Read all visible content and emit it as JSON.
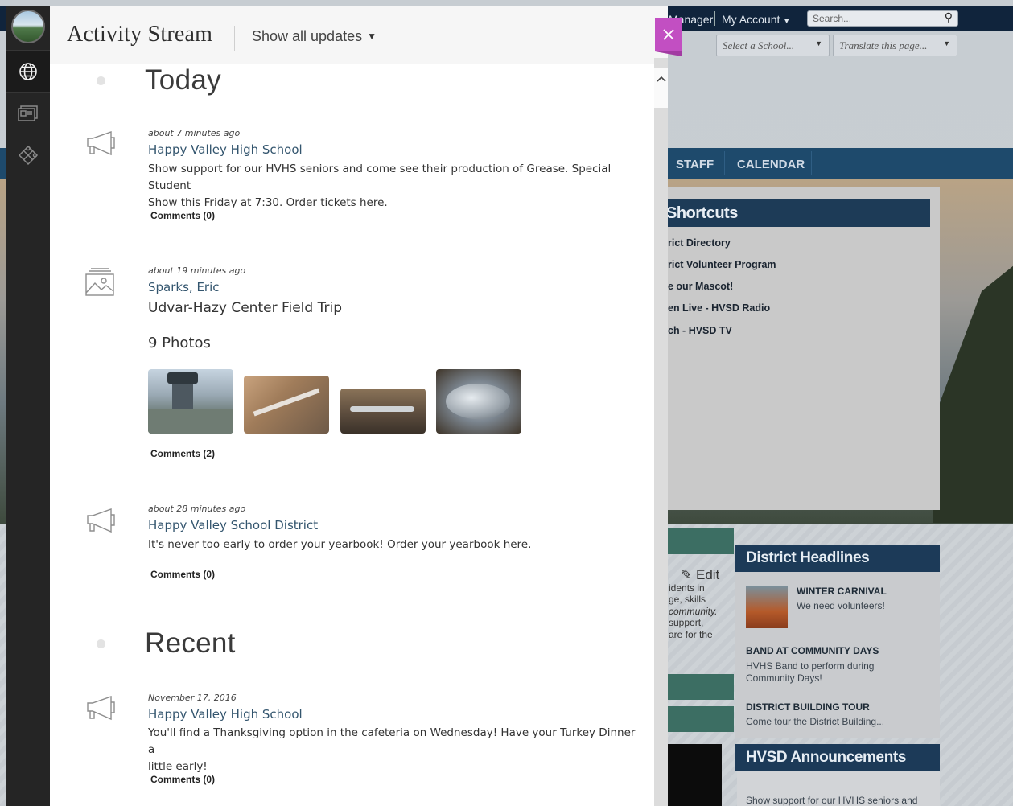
{
  "panel": {
    "title": "Activity Stream",
    "filter_label": "Show all updates"
  },
  "sections": [
    {
      "title": "Today"
    },
    {
      "title": "Recent"
    }
  ],
  "posts": [
    {
      "time": "about 7 minutes ago",
      "author": "Happy Valley High School",
      "body_line1": "Show support for our HVHS seniors and come see their production of Grease. Special Student",
      "body_line2": "Show this Friday at 7:30. Order tickets here.",
      "comments": "Comments (0)"
    },
    {
      "time": "about 19 minutes ago",
      "author": "Sparks, Eric",
      "headline": "Udvar-Hazy Center Field Trip",
      "photo_count": "9 Photos",
      "comments": "Comments (2)"
    },
    {
      "time": "about 28 minutes ago",
      "author": "Happy Valley School District",
      "body_line1": "It's never too early to order your yearbook! Order your yearbook here.",
      "comments": "Comments (0)"
    },
    {
      "time": "November 17, 2016",
      "author": "Happy Valley High School",
      "body_line1": "You'll find a Thanksgiving option in the cafeteria on Wednesday! Have your Turkey Dinner a",
      "body_line2": "little early!",
      "comments": "Comments (0)"
    }
  ],
  "background_site": {
    "top_links": [
      "Manager",
      "My Account"
    ],
    "search_placeholder": "Search...",
    "school_select": "Select a School...",
    "translate_select": "Translate this page...",
    "nav": [
      "STAFF",
      "CALENDAR"
    ],
    "shortcuts_title": "Shortcuts",
    "shortcuts": [
      "rict Directory",
      "rict Volunteer Program",
      "e our Mascot!",
      "en Live - HVSD Radio",
      "ch - HVSD TV"
    ],
    "edit_label": "Edit",
    "partial_text": [
      "idents in",
      "ge, skills",
      "community.",
      "support,",
      "are for the"
    ],
    "headlines_title": "District Headlines",
    "headlines": [
      {
        "title": "WINTER CARNIVAL",
        "desc": "We need volunteers!"
      },
      {
        "title": "BAND AT COMMUNITY DAYS",
        "desc_line1": "HVHS Band to perform during",
        "desc_line2": "Community Days!"
      },
      {
        "title": "DISTRICT BUILDING TOUR",
        "desc": "Come tour the District Building..."
      }
    ],
    "announcements_title": "HVSD Announcements",
    "announcement_text": "Show support for our HVHS seniors and"
  },
  "colors": {
    "accent_close": "#c24fc2",
    "author_link": "#33556e",
    "rail": "#252525"
  }
}
